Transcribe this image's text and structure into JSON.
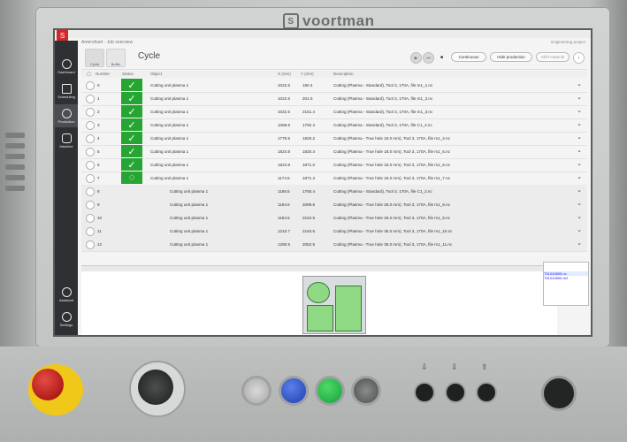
{
  "brand": {
    "name": "voortman"
  },
  "app": {
    "breadcrumb": "Amersfoort - Job overview",
    "project": "Engineering project",
    "view_title": "Cycle",
    "toolbar": {
      "cycle_label": "Cycle",
      "buffer_label": "Buffer",
      "continuous_label": "Continuous",
      "hide_production_label": "Hide production",
      "shift_material_label": "Shift material"
    },
    "sidebar": [
      {
        "label": "Dashboard",
        "icon": "gauge-icon"
      },
      {
        "label": "Scheduling",
        "icon": "schedule-icon"
      },
      {
        "label": "Production",
        "icon": "gear-icon"
      },
      {
        "label": "Machine",
        "icon": "hand-icon"
      },
      {
        "label": "Assistant",
        "icon": "question-icon"
      },
      {
        "label": "Settings",
        "icon": "cog-icon"
      }
    ],
    "table": {
      "headers": [
        "Number",
        "Status",
        "Object",
        "X (mm)",
        "Y (mm)",
        "Description"
      ],
      "rows": [
        {
          "n": "0",
          "status": "done",
          "obj": "Cutting unit plasma 1",
          "x": "1022.5",
          "y": "180.4",
          "desc": "Cutting (Plasma - Standard), Tool 3, 170A, file m1_1.nc"
        },
        {
          "n": "1",
          "status": "done",
          "obj": "Cutting unit plasma 1",
          "x": "1022.5",
          "y": "201.5",
          "desc": "Cutting (Plasma - Standard), Tool 3, 170A, file m1_2.nc"
        },
        {
          "n": "2",
          "status": "done",
          "obj": "Cutting unit plasma 1",
          "x": "1022.5",
          "y": "2151.4",
          "desc": "Cutting (Plasma - Standard), Tool 3, 170A, file m1_3.nc"
        },
        {
          "n": "3",
          "status": "done",
          "obj": "Cutting unit plasma 1",
          "x": "1068.6",
          "y": "1792.4",
          "desc": "Cutting (Plasma - Standard), Tool 3, 170A, file C1_4.nc"
        },
        {
          "n": "4",
          "status": "done",
          "obj": "Cutting unit plasma 1",
          "x": "1779.5",
          "y": "1820.2",
          "desc": "Cutting (Plasma - True hole 18.0 mm), Tool 3, 170A, file m1_4.nc"
        },
        {
          "n": "5",
          "status": "done",
          "obj": "Cutting unit plasma 1",
          "x": "1824.8",
          "y": "1820.4",
          "desc": "Cutting (Plasma - True hole 18.0 mm), Tool 3, 170A, file m1_5.nc"
        },
        {
          "n": "6",
          "status": "done",
          "obj": "Cutting unit plasma 1",
          "x": "1824.8",
          "y": "1871.0",
          "desc": "Cutting (Plasma - True hole 18.0 mm), Tool 3, 170A, file m1_6.nc"
        },
        {
          "n": "7",
          "status": "running",
          "obj": "Cutting unit plasma 1",
          "x": "1174.5",
          "y": "1871.4",
          "desc": "Cutting (Plasma - True hole 18.0 mm), Tool 3, 170A, file m1_7.nc"
        },
        {
          "n": "8",
          "status": "",
          "obj": "Cutting unit plasma 1",
          "x": "1166.5",
          "y": "1755.4",
          "desc": "Cutting (Plasma - Standard), Tool 3, 170A, file C1_2.nc"
        },
        {
          "n": "9",
          "status": "",
          "obj": "Cutting unit plasma 1",
          "x": "1184.6",
          "y": "2099.5",
          "desc": "Cutting (Plasma - True hole 25.0 mm), Tool 3, 170A, file m1_8.nc"
        },
        {
          "n": "10",
          "status": "",
          "obj": "Cutting unit plasma 1",
          "x": "1184.5",
          "y": "2164.5",
          "desc": "Cutting (Plasma - True hole 25.0 mm), Tool 3, 170A, file m1_9.nc"
        },
        {
          "n": "11",
          "status": "",
          "obj": "Cutting unit plasma 1",
          "x": "1210.7",
          "y": "2164.5",
          "desc": "Cutting (Plasma - True hole 35.0 mm), Tool 3, 170A, file m1_10.nc"
        },
        {
          "n": "12",
          "status": "",
          "obj": "Cutting unit plasma 1",
          "x": "1290.5",
          "y": "2052.5",
          "desc": "Cutting (Plasma - True hole 35.0 mm), Tool 3, 170A, file m1_11.nc"
        }
      ]
    },
    "side_panel": {
      "items": [
        "T51043890.nc",
        "T51043890.dxf"
      ]
    }
  },
  "controls": {
    "switch_labels": [
      "⇩",
      "⇩",
      "⇪"
    ]
  },
  "colors": {
    "status_green": "#27a533",
    "accent_red": "#d3282b",
    "estop_yellow": "#f0c81a"
  }
}
